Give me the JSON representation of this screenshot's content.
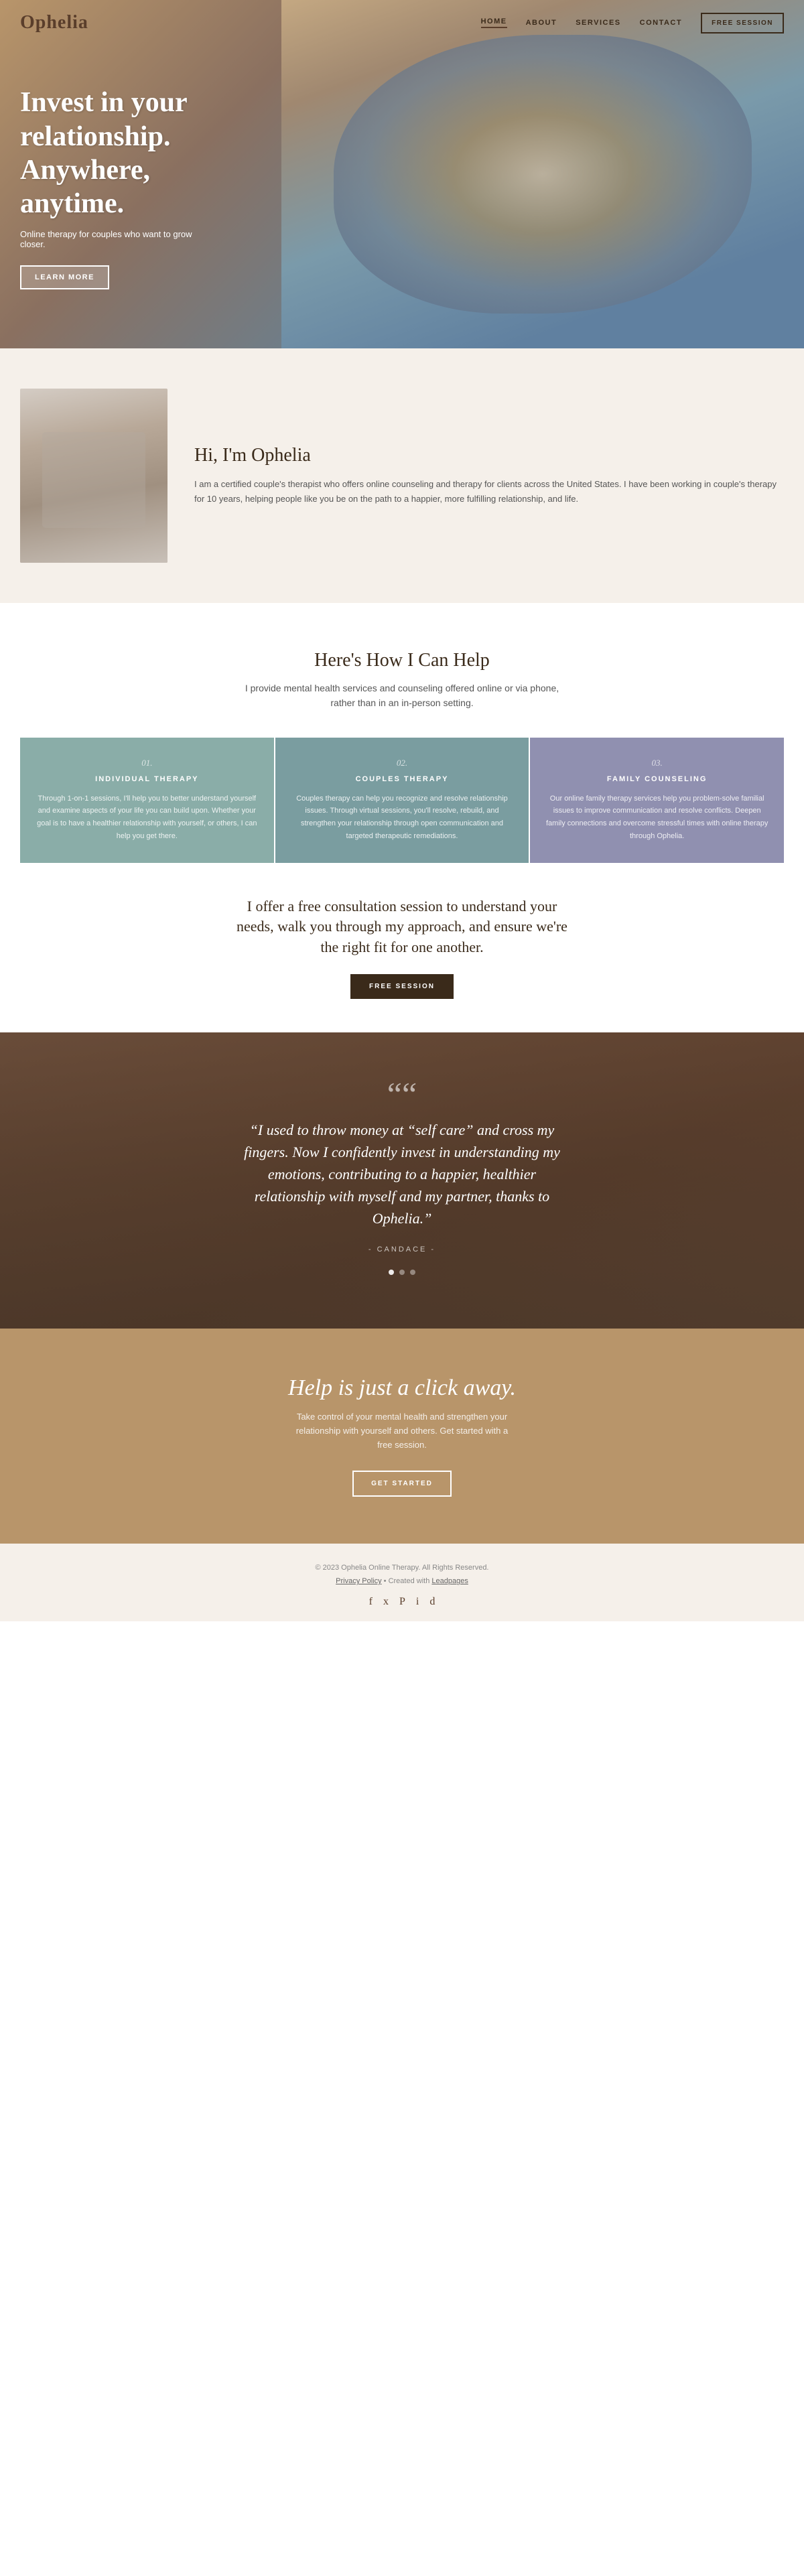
{
  "nav": {
    "logo": "Ophelia",
    "links": [
      {
        "label": "HOME",
        "active": true
      },
      {
        "label": "ABOUT",
        "active": false
      },
      {
        "label": "SERVICES",
        "active": false
      },
      {
        "label": "CONTACT",
        "active": false
      }
    ],
    "cta": "FREE SESSION"
  },
  "hero": {
    "title": "Invest in your relationship. Anywhere, anytime.",
    "subtitle": "Online therapy for couples who want to grow closer.",
    "cta": "LEARN MORE"
  },
  "about": {
    "title": "Hi, I'm Ophelia",
    "body": "I am a certified couple's therapist who offers online counseling and therapy for clients across the United States. I have been working in couple's therapy for 10 years, helping people like you be on the path to a happier, more fulfilling relationship, and life."
  },
  "services": {
    "section_title": "Here's How I Can Help",
    "section_desc": "I provide mental health services and counseling offered online or via phone, rather than in an in-person setting.",
    "cards": [
      {
        "num": "01.",
        "name": "INDIVIDUAL THERAPY",
        "body": "Through 1-on-1 sessions, I'll help you to better understand yourself and examine aspects of your life you can build upon. Whether your goal is to have a healthier relationship with yourself, or others, I can help you get there."
      },
      {
        "num": "02.",
        "name": "COUPLES THERAPY",
        "body": "Couples therapy can help you recognize and resolve relationship issues. Through virtual sessions, you'll resolve, rebuild, and strengthen your relationship through open communication and targeted therapeutic remediations."
      },
      {
        "num": "03.",
        "name": "FAMILY COUNSELING",
        "body": "Our online family therapy services help you problem-solve familial issues to improve communication and resolve conflicts. Deepen family connections and overcome stressful times with online therapy through Ophelia."
      }
    ],
    "consult_text": "I offer a free consultation session to understand your needs, walk you through my approach, and ensure we're the right fit for one another.",
    "consult_btn": "FREE SESSION"
  },
  "testimonial": {
    "quote_mark": "““",
    "text": "“I used to throw money at “self care” and cross my fingers. Now I confidently invest in understanding my emotions, contributing to a happier, healthier relationship with myself and my partner, thanks to Ophelia.”",
    "author": "- CANDACE -"
  },
  "cta": {
    "title": "Help is just a click away.",
    "subtitle": "Take control of your mental health and strengthen your relationship with yourself and others. Get started with a free session.",
    "btn": "GET STARTED"
  },
  "footer": {
    "copy": "© 2023 Ophelia Online Therapy. All Rights Reserved.",
    "privacy": "Privacy Policy",
    "created_with": "Created with",
    "leadpages": "Leadpages",
    "social_icons": [
      "f",
      "𝕏",
      "♦",
      "◎",
      "♪"
    ]
  }
}
